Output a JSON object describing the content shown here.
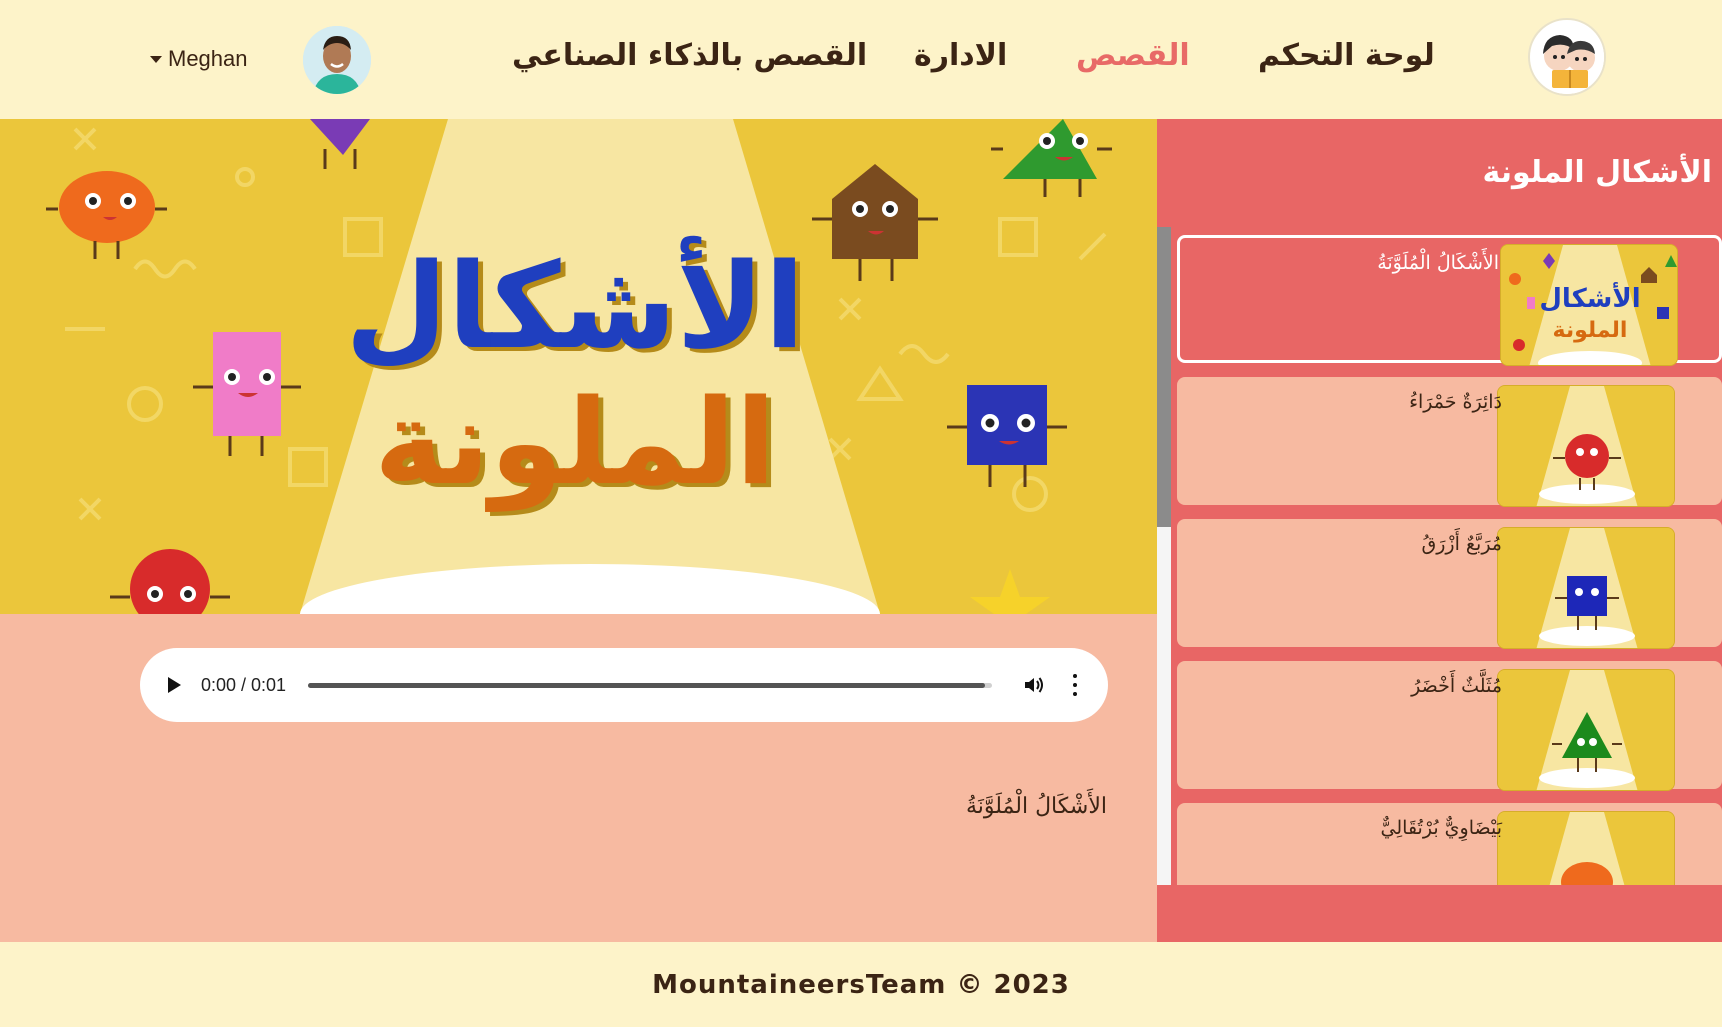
{
  "header": {
    "nav": {
      "dashboard": "لوحة التحكم",
      "stories": "القصص",
      "management": "الادارة",
      "ai_stories": "القصص بالذكاء الصناعي"
    },
    "user_name": "Meghan",
    "active_color": "#e86a67"
  },
  "story": {
    "cover_title_line1": "الأشكال",
    "cover_title_line2": "الملونة",
    "text": "الأَشْكَالُ الْمُلَوَّنَةُ"
  },
  "audio": {
    "time": "0:00 / 0:01",
    "progress": 0.99
  },
  "sidebar": {
    "title": "الأشكال الملونة",
    "items": [
      {
        "label": "الأَشْكَالُ الْمُلَوَّنَةُ",
        "active": true,
        "thumb_icon": "cover-icon"
      },
      {
        "label": "دَائِرَةٌ حَمْرَاءُ",
        "active": false,
        "thumb_icon": "red-circle-icon"
      },
      {
        "label": "مُرَبَّعٌ أَزْرَقُ",
        "active": false,
        "thumb_icon": "blue-square-icon"
      },
      {
        "label": "مُثَلَّثٌ أَخْضَرُ",
        "active": false,
        "thumb_icon": "green-triangle-icon"
      },
      {
        "label": "بَيْضَاوِيٌّ بُرْتُقَالِيٌّ",
        "active": false,
        "thumb_icon": "orange-oval-icon"
      }
    ]
  },
  "footer": {
    "copyright": "MountaineersTeam © 2023"
  },
  "colors": {
    "background": "#fdf3c9",
    "sidebar": "#e86665",
    "card": "#f7baa1",
    "story_bg": "#ebc63b"
  }
}
